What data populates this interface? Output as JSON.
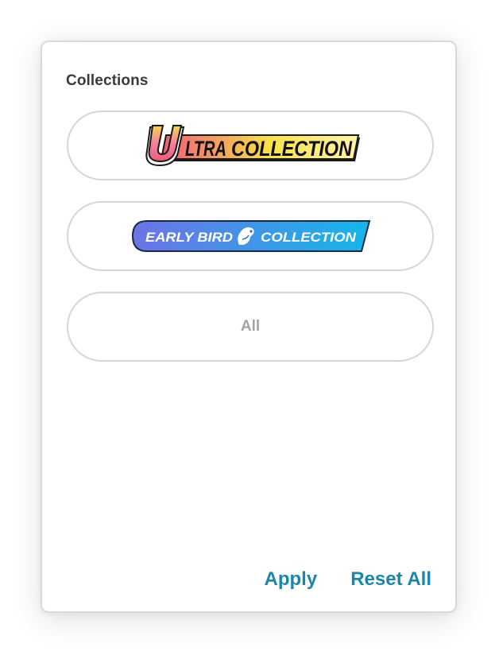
{
  "filter": {
    "section_title": "Collections",
    "options": [
      {
        "logo_icon": "ultra-collection-logo",
        "logo_text_ultra_letter": "U",
        "logo_text_ultra_rest": "LTRA",
        "logo_text_collection": "COLLECTION",
        "colors": {
          "gradient_start": "#f05a78",
          "gradient_mid": "#f7e24a",
          "gradient_end": "#fff4a8"
        }
      },
      {
        "logo_icon": "early-bird-collection-logo",
        "logo_text_left": "EARLY BIRD",
        "logo_text_right": "COLLECTION",
        "colors": {
          "gradient_start": "#6d73e6",
          "gradient_end": "#14b6e8"
        }
      },
      {
        "label": "All"
      }
    ]
  },
  "actions": {
    "apply_label": "Apply",
    "reset_label": "Reset All",
    "link_color": "#1c86a8"
  }
}
